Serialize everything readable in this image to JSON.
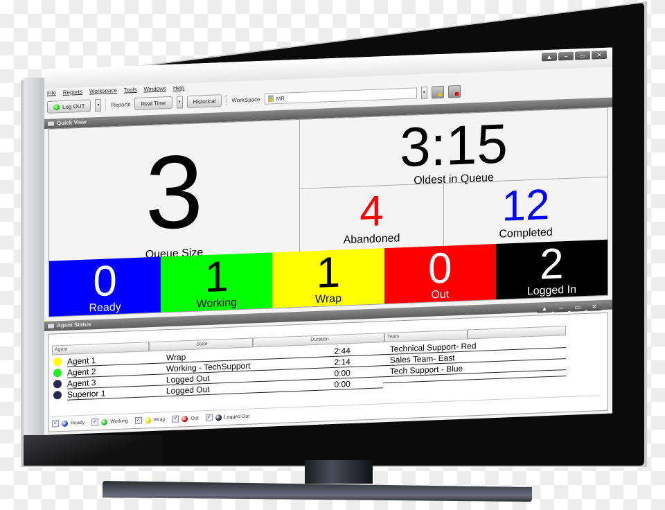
{
  "window": {
    "controls": [
      "▲",
      "–",
      "▭",
      "✕"
    ]
  },
  "menu": [
    "File",
    "Reports",
    "Workspace",
    "Tools",
    "Windows",
    "Help"
  ],
  "toolbar": {
    "logout_label": "Log OUT",
    "reports_label": "Reports",
    "realtime_label": "Real Time",
    "historical_label": "Historical",
    "workspace_label": "WorkSpace",
    "workspace_value": "MR"
  },
  "quick_view": {
    "title": "Quick View",
    "queue_size": {
      "value": "3",
      "label": "Queue Size"
    },
    "oldest_in_queue": {
      "value": "3:15",
      "label": "Oldest in Queue"
    },
    "abandoned": {
      "value": "4",
      "label": "Abandoned",
      "color": "#ff0000"
    },
    "completed": {
      "value": "12",
      "label": "Completed",
      "color": "#0000ff"
    },
    "status_blocks": [
      {
        "value": "0",
        "label": "Ready",
        "bg": "#0000ff",
        "fg": "#ffffff"
      },
      {
        "value": "1",
        "label": "Working",
        "bg": "#00ff00",
        "fg": "#000000"
      },
      {
        "value": "1",
        "label": "Wrap",
        "bg": "#ffff00",
        "fg": "#000000"
      },
      {
        "value": "0",
        "label": "Out",
        "bg": "#ff0000",
        "fg": "#ffffff"
      },
      {
        "value": "2",
        "label": "Logged In",
        "bg": "#000000",
        "fg": "#ffffff"
      }
    ]
  },
  "agent_status": {
    "title": "Agent Status",
    "columns": [
      "Agent",
      "State",
      "Duration",
      "Team"
    ],
    "rows": [
      {
        "agent": "Agent 1",
        "state": "Wrap",
        "duration": "2:44",
        "team": "Technical Support- Red",
        "dot": "#ffff00"
      },
      {
        "agent": "Agent 2",
        "state": "Working - TechSupport",
        "duration": "2:14",
        "team": "Sales Team- East",
        "dot": "#22ee22"
      },
      {
        "agent": "Agent 3",
        "state": "Logged Out",
        "duration": "0:00",
        "team": "Tech Support - Blue",
        "dot": "#26294f"
      },
      {
        "agent": "Superior 1",
        "state": "Logged Out",
        "duration": "0:00",
        "team": "",
        "dot": "#26294f"
      }
    ],
    "legend": [
      {
        "label": "Ready",
        "color": "#3a4fd0",
        "checked": true
      },
      {
        "label": "Working",
        "color": "#1ec81e",
        "checked": true
      },
      {
        "label": "Wrap",
        "color": "#f2e200",
        "checked": true
      },
      {
        "label": "Out",
        "color": "#e01010",
        "checked": true
      },
      {
        "label": "Logged Out",
        "color": "#1c1f3c",
        "checked": true
      }
    ]
  }
}
